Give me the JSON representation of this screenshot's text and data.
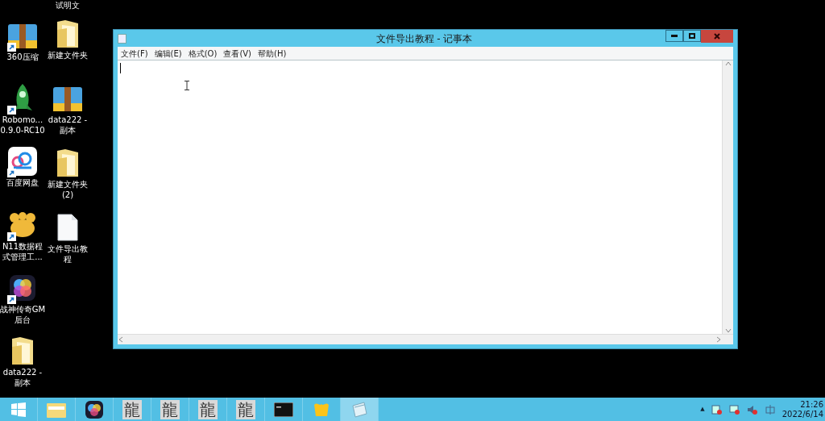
{
  "desktop": {
    "columns": [
      [
        {
          "label": [
            "360压缩"
          ],
          "kind": "zip",
          "shortcut": true
        },
        {
          "label": [
            "Robomo...",
            "0.9.0-RC10"
          ],
          "kind": "rocket",
          "shortcut": true
        },
        {
          "label": [
            "百度网盘"
          ],
          "kind": "cloud",
          "shortcut": true
        },
        {
          "label": [
            "N11数据程",
            "式管理工..."
          ],
          "kind": "flower",
          "shortcut": true
        },
        {
          "label": [
            "战神传奇GM",
            "后台"
          ],
          "kind": "colorful",
          "shortcut": true
        },
        {
          "label": [
            "data222 -",
            "副本"
          ],
          "kind": "folder",
          "shortcut": false
        }
      ],
      [
        {
          "label": [
            "试明文"
          ],
          "kind": "none"
        },
        {
          "label": [
            "新建文件夹"
          ],
          "kind": "folder",
          "shortcut": false
        },
        {
          "label": [
            "data222 -",
            "副本"
          ],
          "kind": "zip",
          "shortcut": false
        },
        {
          "label": [
            "新建文件夹",
            "(2)"
          ],
          "kind": "folder",
          "shortcut": false
        },
        {
          "label": [
            "文件导出教",
            "程"
          ],
          "kind": "doc",
          "shortcut": false
        }
      ]
    ]
  },
  "window": {
    "title": "文件导出教程 - 记事本",
    "menu": [
      "文件(F)",
      "编辑(E)",
      "格式(O)",
      "查看(V)",
      "帮助(H)"
    ]
  },
  "taskbar": {
    "items": [
      {
        "kind": "start",
        "selected": false
      },
      {
        "kind": "explorer",
        "selected": false
      },
      {
        "kind": "colorful",
        "selected": false
      },
      {
        "kind": "glyph",
        "glyph": "龍",
        "selected": false
      },
      {
        "kind": "glyph",
        "glyph": "龍",
        "selected": false
      },
      {
        "kind": "glyph",
        "glyph": "龍",
        "selected": false
      },
      {
        "kind": "glyph",
        "glyph": "龍",
        "selected": false
      },
      {
        "kind": "console",
        "selected": false
      },
      {
        "kind": "yellow",
        "selected": false
      },
      {
        "kind": "notepad",
        "selected": true
      }
    ],
    "tray_expander": "▲",
    "time": "21:26",
    "date": "2022/6/14"
  }
}
